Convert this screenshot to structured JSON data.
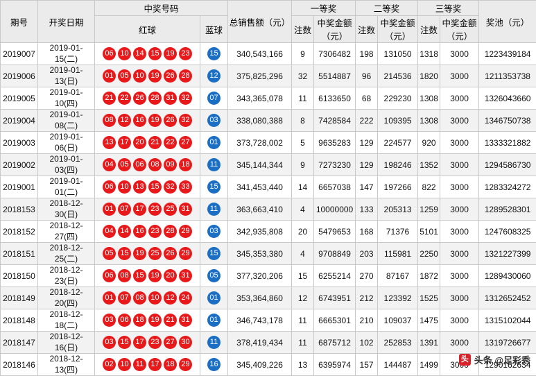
{
  "header": {
    "issue": "期号",
    "date": "开奖日期",
    "winning_numbers": "中奖号码",
    "red_balls": "红球",
    "blue_ball": "蓝球",
    "total_sales": "总销售额（元）",
    "prize1": "一等奖",
    "prize2": "二等奖",
    "prize3": "三等奖",
    "pool": "奖池（元）",
    "count": "注数",
    "amount": "中奖金额（元）"
  },
  "watermark": {
    "icon": "头",
    "text": "头条 @足彩秀"
  },
  "rows": [
    {
      "issue": "2019007",
      "date": "2019-01-15(二)",
      "red": [
        "06",
        "10",
        "14",
        "15",
        "19",
        "23"
      ],
      "blue": "15",
      "sales": "340,543,166",
      "c1": "9",
      "a1": "7306482",
      "c2": "198",
      "a2": "131050",
      "c3": "1318",
      "a3": "3000",
      "pool": "1223439184"
    },
    {
      "issue": "2019006",
      "date": "2019-01-13(日)",
      "red": [
        "01",
        "05",
        "10",
        "19",
        "26",
        "28"
      ],
      "blue": "12",
      "sales": "375,825,296",
      "c1": "32",
      "a1": "5514887",
      "c2": "96",
      "a2": "214536",
      "c3": "1820",
      "a3": "3000",
      "pool": "1211353738"
    },
    {
      "issue": "2019005",
      "date": "2019-01-10(四)",
      "red": [
        "21",
        "22",
        "26",
        "28",
        "31",
        "32"
      ],
      "blue": "07",
      "sales": "343,365,078",
      "c1": "11",
      "a1": "6133650",
      "c2": "68",
      "a2": "229230",
      "c3": "1308",
      "a3": "3000",
      "pool": "1326043660"
    },
    {
      "issue": "2019004",
      "date": "2019-01-08(二)",
      "red": [
        "08",
        "12",
        "16",
        "19",
        "26",
        "32"
      ],
      "blue": "03",
      "sales": "338,080,388",
      "c1": "8",
      "a1": "7428584",
      "c2": "222",
      "a2": "109395",
      "c3": "1308",
      "a3": "3000",
      "pool": "1346750738"
    },
    {
      "issue": "2019003",
      "date": "2019-01-06(日)",
      "red": [
        "13",
        "17",
        "20",
        "21",
        "22",
        "27"
      ],
      "blue": "01",
      "sales": "373,728,002",
      "c1": "5",
      "a1": "9635283",
      "c2": "129",
      "a2": "224577",
      "c3": "920",
      "a3": "3000",
      "pool": "1333321882"
    },
    {
      "issue": "2019002",
      "date": "2019-01-03(四)",
      "red": [
        "04",
        "05",
        "06",
        "08",
        "09",
        "18"
      ],
      "blue": "11",
      "sales": "345,144,344",
      "c1": "9",
      "a1": "7273230",
      "c2": "129",
      "a2": "198246",
      "c3": "1352",
      "a3": "3000",
      "pool": "1294586730"
    },
    {
      "issue": "2019001",
      "date": "2019-01-01(二)",
      "red": [
        "06",
        "10",
        "13",
        "15",
        "32",
        "33"
      ],
      "blue": "15",
      "sales": "341,453,440",
      "c1": "14",
      "a1": "6657038",
      "c2": "147",
      "a2": "197266",
      "c3": "822",
      "a3": "3000",
      "pool": "1283324272"
    },
    {
      "issue": "2018153",
      "date": "2018-12-30(日)",
      "red": [
        "01",
        "07",
        "17",
        "23",
        "25",
        "31"
      ],
      "blue": "11",
      "sales": "363,663,410",
      "c1": "4",
      "a1": "10000000",
      "c2": "133",
      "a2": "205313",
      "c3": "1259",
      "a3": "3000",
      "pool": "1289528301"
    },
    {
      "issue": "2018152",
      "date": "2018-12-27(四)",
      "red": [
        "04",
        "14",
        "16",
        "23",
        "28",
        "29"
      ],
      "blue": "03",
      "sales": "342,935,808",
      "c1": "20",
      "a1": "5479653",
      "c2": "168",
      "a2": "71376",
      "c3": "5101",
      "a3": "3000",
      "pool": "1247608325"
    },
    {
      "issue": "2018151",
      "date": "2018-12-25(二)",
      "red": [
        "05",
        "15",
        "19",
        "25",
        "26",
        "29"
      ],
      "blue": "15",
      "sales": "345,353,380",
      "c1": "4",
      "a1": "9708849",
      "c2": "203",
      "a2": "115981",
      "c3": "2250",
      "a3": "3000",
      "pool": "1321227399"
    },
    {
      "issue": "2018150",
      "date": "2018-12-23(日)",
      "red": [
        "06",
        "08",
        "15",
        "19",
        "20",
        "31"
      ],
      "blue": "05",
      "sales": "377,320,206",
      "c1": "15",
      "a1": "6255214",
      "c2": "270",
      "a2": "87167",
      "c3": "1872",
      "a3": "3000",
      "pool": "1289430060"
    },
    {
      "issue": "2018149",
      "date": "2018-12-20(四)",
      "red": [
        "01",
        "07",
        "08",
        "10",
        "12",
        "24"
      ],
      "blue": "01",
      "sales": "353,364,860",
      "c1": "12",
      "a1": "6743951",
      "c2": "212",
      "a2": "123392",
      "c3": "1525",
      "a3": "3000",
      "pool": "1312652452"
    },
    {
      "issue": "2018148",
      "date": "2018-12-18(二)",
      "red": [
        "03",
        "06",
        "18",
        "19",
        "21",
        "31"
      ],
      "blue": "01",
      "sales": "346,743,178",
      "c1": "11",
      "a1": "6665301",
      "c2": "210",
      "a2": "109037",
      "c3": "1475",
      "a3": "3000",
      "pool": "1315102044"
    },
    {
      "issue": "2018147",
      "date": "2018-12-16(日)",
      "red": [
        "03",
        "15",
        "17",
        "23",
        "27",
        "30"
      ],
      "blue": "11",
      "sales": "378,419,434",
      "c1": "11",
      "a1": "6875712",
      "c2": "102",
      "a2": "252853",
      "c3": "1391",
      "a3": "3000",
      "pool": "1319726677"
    },
    {
      "issue": "2018146",
      "date": "2018-12-13(四)",
      "red": [
        "02",
        "10",
        "11",
        "17",
        "18",
        "29"
      ],
      "blue": "16",
      "sales": "345,409,226",
      "c1": "13",
      "a1": "6395974",
      "c2": "157",
      "a2": "144487",
      "c3": "1499",
      "a3": "3000",
      "pool": "1290162634"
    }
  ]
}
